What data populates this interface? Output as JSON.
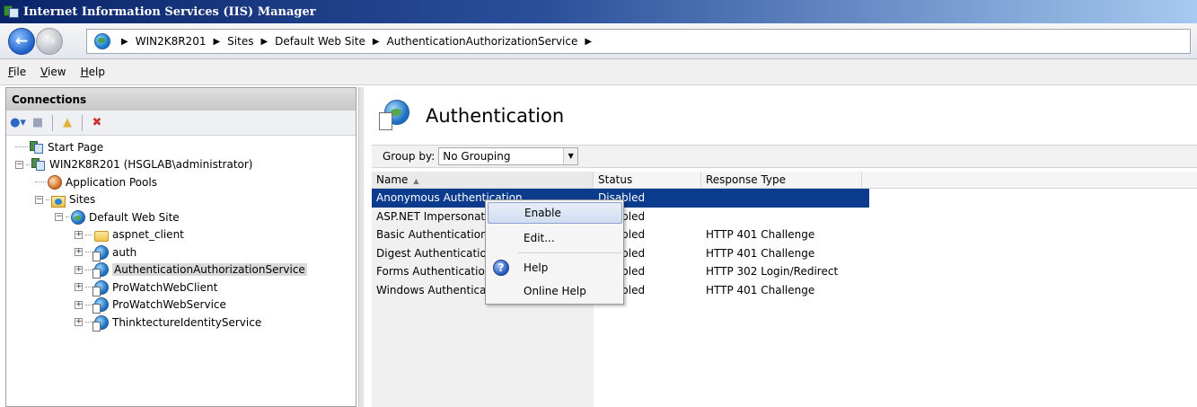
{
  "window": {
    "title": "Internet Information Services (IIS) Manager"
  },
  "breadcrumbs": [
    "WIN2K8R201",
    "Sites",
    "Default Web Site",
    "AuthenticationAuthorizationService"
  ],
  "menu": [
    {
      "label": "File",
      "key": "F",
      "rest": "ile"
    },
    {
      "label": "View",
      "key": "V",
      "rest": "iew"
    },
    {
      "label": "Help",
      "key": "H",
      "rest": "elp"
    }
  ],
  "connections": {
    "header": "Connections",
    "toolbar_icons": [
      "connect-icon",
      "save-icon",
      "up-folder-icon",
      "disconnect-icon"
    ],
    "tree": [
      {
        "label": "Start Page",
        "icon": "start-page-icon"
      },
      {
        "label": "WIN2K8R201 (HSGLAB\\administrator)",
        "icon": "server-icon",
        "expanded": true
      },
      {
        "label": "Application Pools",
        "icon": "app-pools-icon"
      },
      {
        "label": "Sites",
        "icon": "sites-icon",
        "expanded": true
      },
      {
        "label": "Default Web Site",
        "icon": "website-icon",
        "expanded": true
      },
      {
        "label": "aspnet_client",
        "icon": "folder-icon"
      },
      {
        "label": "auth",
        "icon": "application-icon"
      },
      {
        "label": "AuthenticationAuthorizationService",
        "icon": "application-icon",
        "selected": true
      },
      {
        "label": "ProWatchWebClient",
        "icon": "application-icon"
      },
      {
        "label": "ProWatchWebService",
        "icon": "application-icon"
      },
      {
        "label": "ThinktectureIdentityService",
        "icon": "application-icon"
      }
    ]
  },
  "main": {
    "title": "Authentication",
    "group_by_label": "Group by:",
    "group_by_value": "No Grouping",
    "columns": [
      "Name",
      "Status",
      "Response Type"
    ],
    "rows": [
      {
        "name": "Anonymous Authentication",
        "status": "Disabled",
        "response": ""
      },
      {
        "name": "ASP.NET Impersonation",
        "status": "Disabled",
        "response": ""
      },
      {
        "name": "Basic Authentication",
        "status": "Disabled",
        "response": "HTTP 401 Challenge"
      },
      {
        "name": "Digest Authentication",
        "status": "Disabled",
        "response": "HTTP 401 Challenge"
      },
      {
        "name": "Forms Authentication",
        "status": "Disabled",
        "response": "HTTP 302 Login/Redirect"
      },
      {
        "name": "Windows Authentication",
        "status": "Disabled",
        "response": "HTTP 401 Challenge"
      }
    ],
    "selected_row": 0
  },
  "context_menu": {
    "items": [
      "Enable",
      "Edit...",
      "Help",
      "Online Help"
    ],
    "highlighted": "Enable"
  },
  "colors": {
    "selection": "#0b3b8c",
    "titlebar": "#0a246a"
  }
}
